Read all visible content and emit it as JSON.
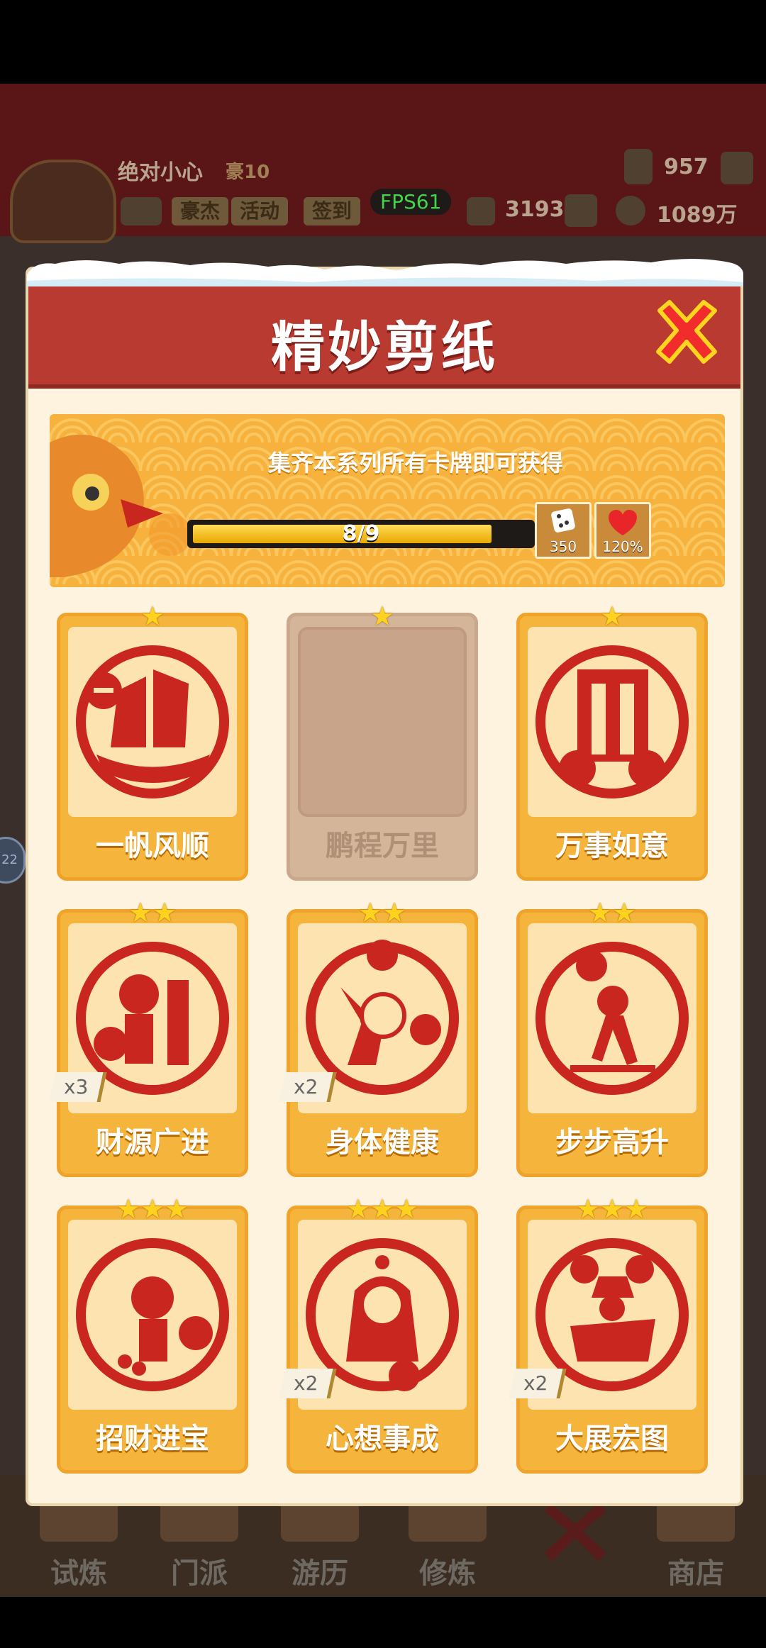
{
  "hud": {
    "player_name": "绝对小心",
    "player_tag": "豪10",
    "chips": [
      "豪杰",
      "活动",
      "签到"
    ],
    "fps": "FPS61",
    "gems": "957",
    "tickets": "3193",
    "gold": "1089万",
    "side_badge": "22"
  },
  "modal": {
    "title": "精妙剪纸",
    "banner_text": "集齐本系列所有卡牌即可获得",
    "progress": {
      "text": "8/9",
      "current": 8,
      "total": 9
    },
    "rewards": [
      {
        "icon": "dice-icon",
        "value": "350"
      },
      {
        "icon": "heart-icon",
        "value": "120%"
      }
    ]
  },
  "cards": [
    {
      "label": "一帆风顺",
      "stars": "★",
      "count": "",
      "locked": false
    },
    {
      "label": "鹏程万里",
      "stars": "★",
      "count": "",
      "locked": true
    },
    {
      "label": "万事如意",
      "stars": "★",
      "count": "",
      "locked": false
    },
    {
      "label": "财源广进",
      "stars": "★★",
      "count": "x3",
      "locked": false
    },
    {
      "label": "身体健康",
      "stars": "★★",
      "count": "x2",
      "locked": false
    },
    {
      "label": "步步高升",
      "stars": "★★",
      "count": "",
      "locked": false
    },
    {
      "label": "招财进宝",
      "stars": "★★★",
      "count": "",
      "locked": false
    },
    {
      "label": "心想事成",
      "stars": "★★★",
      "count": "x2",
      "locked": false
    },
    {
      "label": "大展宏图",
      "stars": "★★★",
      "count": "x2",
      "locked": false
    }
  ],
  "nav": {
    "items": [
      "试炼",
      "门派",
      "游历",
      "修炼",
      "",
      "商店"
    ]
  },
  "colors": {
    "header_red": "#b83a30",
    "card_gold": "#f5b53d",
    "paper_red": "#c9261f",
    "locked": "#d4b59a"
  }
}
